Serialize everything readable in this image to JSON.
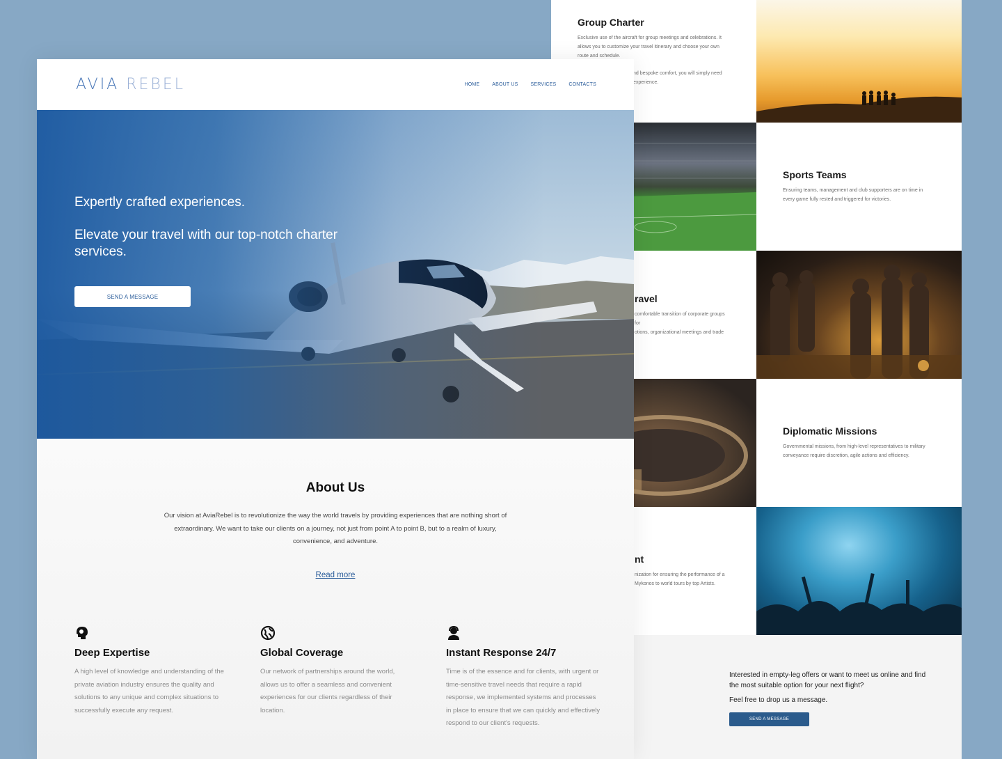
{
  "services": {
    "group_charter": {
      "title": "Group Charter",
      "desc": "Exclusive use of the aircraft for group meetings and celebrations. It allows you to customize your travel itinerary and choose your own route and schedule.",
      "desc_extra": "nd bespoke comfort, you will simply need",
      "desc_extra2": "experience."
    },
    "sports_teams": {
      "title": "Sports Teams",
      "desc": "Ensuring teams, management and club supporters are on time in every game fully rested and triggered for victories."
    },
    "corporate": {
      "title": "ravel",
      "desc": "comfortable transition of corporate groups for",
      "desc2": "otions, organizational meetings and trade"
    },
    "diplomatic": {
      "title": "Diplomatic Missions",
      "desc": "Governmental missions, from high-level representatives to military conveyance require discretion, agile actions and efficiency."
    },
    "entertainment": {
      "title": "nt",
      "desc": "nization for ensuring the performance of a",
      "desc2": "Mykonos to world tours by top Artists."
    },
    "cta": {
      "text": "Interested in empty-leg offers or want to meet us online and find the most suitable option for your next flight?",
      "text2": "Feel free to drop us a message.",
      "button": "SEND A MESSAGE"
    }
  },
  "header": {
    "logo_avia": "AVIA",
    "logo_rebel": "REBEL",
    "nav": [
      "HOME",
      "ABOUT US",
      "SERVICES",
      "CONTACTS"
    ]
  },
  "hero": {
    "headline": "Expertly crafted experiences.",
    "subheadline": "Elevate your travel with our top-notch charter services.",
    "button": "SEND A MESSAGE"
  },
  "about": {
    "title": "About Us",
    "text": "Our vision at AviaRebel is to revolutionize the way the world travels by providing experiences that are nothing short of extraordinary. We want to take our clients on a journey, not just from point A to point B, but to a realm of luxury, convenience, and adventure.",
    "read_more": "Read more",
    "features": [
      {
        "icon": "brain-head-icon",
        "title": "Deep Expertise",
        "desc": "A high level of knowledge and understanding of the private aviation industry ensures the quality and solutions to any unique and complex situations to successfully execute any request."
      },
      {
        "icon": "globe-icon",
        "title": "Global Coverage",
        "desc": "Our network of partnerships around the world, allows us to offer a seamless and convenient experiences for our clients regardless of their location."
      },
      {
        "icon": "support-agent-icon",
        "title": "Instant Response 24/7",
        "desc": "Time is of the essence and for clients, with urgent or time-sensitive travel needs that require a rapid response, we implemented systems and processes in place to ensure that we can quickly and effectively respond to our client's requests."
      }
    ]
  },
  "colors": {
    "accent": "#2a5c9a",
    "background": "#87a8c5",
    "cta_button": "#2b5b8c"
  }
}
